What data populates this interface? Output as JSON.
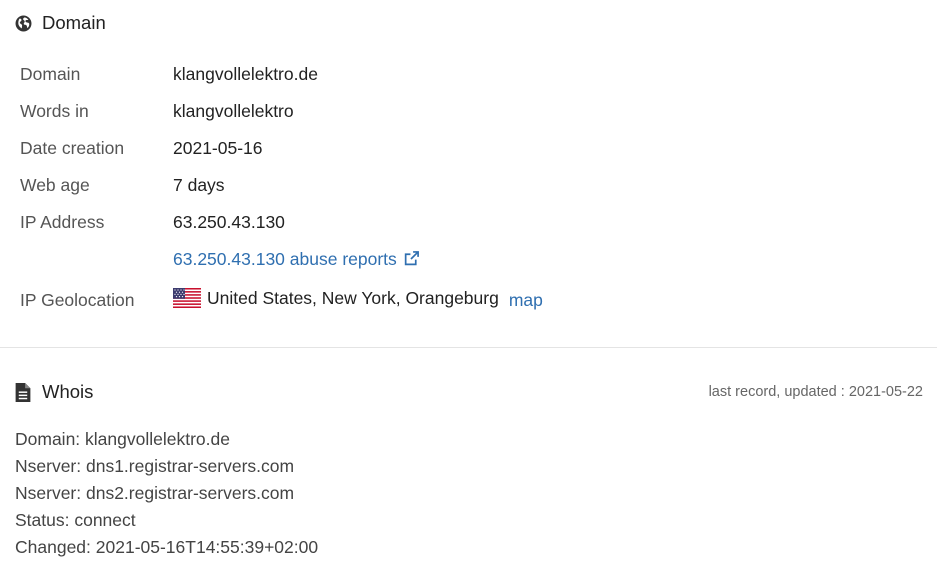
{
  "domain_section": {
    "title": "Domain",
    "icon": "globe-icon",
    "rows": {
      "domain": {
        "label": "Domain",
        "value": "klangvollelektro.de"
      },
      "words_in": {
        "label": "Words in",
        "value": "klangvollelektro"
      },
      "date_creation": {
        "label": "Date creation",
        "value": "2021-05-16"
      },
      "web_age": {
        "label": "Web age",
        "value": "7 days"
      },
      "ip_address": {
        "label": "IP Address",
        "value": "63.250.43.130",
        "abuse_link": "63.250.43.130 abuse reports"
      },
      "ip_geolocation": {
        "label": "IP Geolocation",
        "value": "United States, New York, Orangeburg",
        "map_link": "map",
        "flag": "us-flag-icon"
      }
    }
  },
  "whois_section": {
    "title": "Whois",
    "icon": "document-icon",
    "updated_note": "last record, updated : 2021-05-22",
    "lines": [
      "Domain: klangvollelektro.de",
      "Nserver: dns1.registrar-servers.com",
      "Nserver: dns2.registrar-servers.com",
      "Status: connect",
      "Changed: 2021-05-16T14:55:39+02:00"
    ]
  },
  "colors": {
    "link": "#2f6fb0",
    "label": "#555555",
    "text": "#222222",
    "divider": "#e4e4e4"
  }
}
